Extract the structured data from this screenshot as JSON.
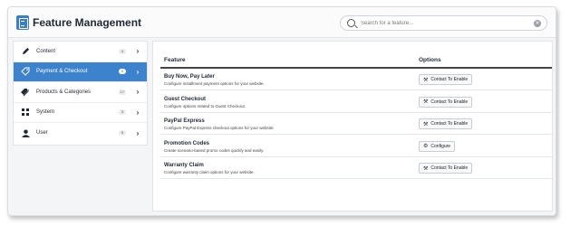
{
  "header": {
    "title": "Feature Management",
    "app_icon": "document-icon"
  },
  "search": {
    "placeholder": "Search for a feature...",
    "value": ""
  },
  "sidebar": {
    "items": [
      {
        "label": "Content",
        "count": "4",
        "icon": "pencil-icon",
        "active": false
      },
      {
        "label": "Payment & Checkout",
        "count": "5",
        "icon": "tag-icon",
        "active": true
      },
      {
        "label": "Products & Categories",
        "count": "17",
        "icon": "tags-icon",
        "active": false
      },
      {
        "label": "System",
        "count": "3",
        "icon": "grid-icon",
        "active": false
      },
      {
        "label": "User",
        "count": "5",
        "icon": "user-icon",
        "active": false
      }
    ],
    "active_color": "#3d82cc"
  },
  "table": {
    "columns": {
      "feature": "Feature",
      "options": "Options"
    },
    "rows": [
      {
        "title": "Buy Now, Pay Later",
        "description": "Configure installment payment options for your website.",
        "action": "Contact To Enable",
        "action_icon": "wrench-icon"
      },
      {
        "title": "Guest Checkout",
        "description": "Configure options related to Guest Checkout.",
        "action": "Contact To Enable",
        "action_icon": "wrench-icon"
      },
      {
        "title": "PayPal Express",
        "description": "Configure PayPal Express checkout options for your website.",
        "action": "Contact To Enable",
        "action_icon": "wrench-icon"
      },
      {
        "title": "Promotion Codes",
        "description": "Create scenario-based promo codes quickly and easily.",
        "action": "Configure",
        "action_icon": "gear-icon"
      },
      {
        "title": "Warranty Claim",
        "description": "Configure warranty claim options for your website.",
        "action": "Contact To Enable",
        "action_icon": "wrench-icon"
      }
    ]
  }
}
